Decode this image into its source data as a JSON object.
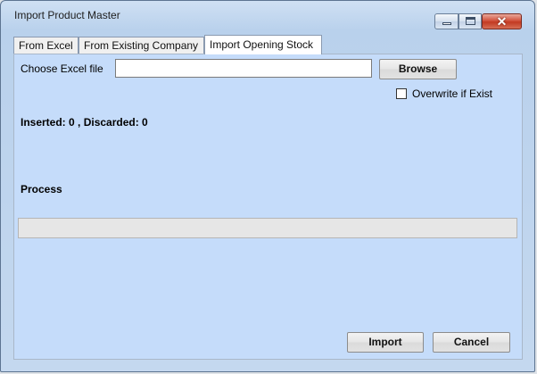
{
  "window": {
    "title": "Import Product Master"
  },
  "tabs": [
    {
      "label": "From Excel"
    },
    {
      "label": "From Existing Company"
    },
    {
      "label": "Import Opening Stock",
      "active": true
    }
  ],
  "form": {
    "choose_file_label": "Choose Excel file",
    "file_value": "",
    "browse_label": "Browse",
    "overwrite_label": "Overwrite if Exist",
    "overwrite_checked": false,
    "status_text": "Inserted: 0 , Discarded: 0",
    "process_label": "Process",
    "progress_percent": 0
  },
  "footer": {
    "import_label": "Import",
    "cancel_label": "Cancel"
  },
  "colors": {
    "panel_bg": "#c5dcfa",
    "close_button": "#c23a22"
  }
}
